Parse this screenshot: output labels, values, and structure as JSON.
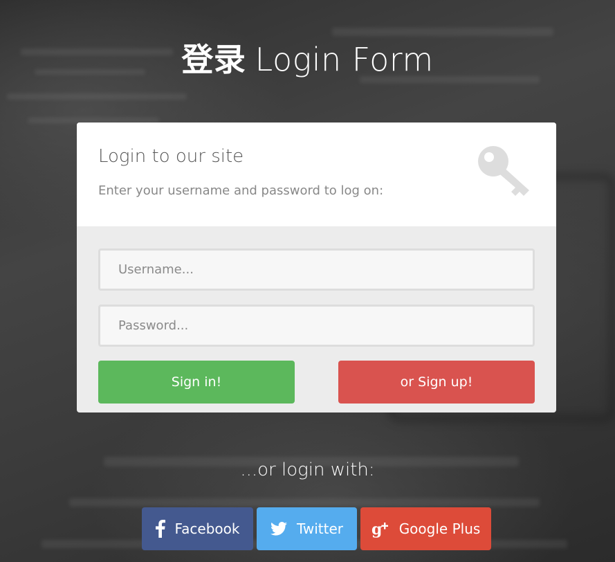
{
  "page": {
    "title_cn": "登录",
    "title_en": "Login Form"
  },
  "card": {
    "heading": "Login to our site",
    "subheading": "Enter your username and password to log on:",
    "icon": "key-icon",
    "username_placeholder": "Username...",
    "password_placeholder": "Password...",
    "signin_label": "Sign in!",
    "signup_label": "or Sign up!"
  },
  "social": {
    "heading": "...or login with:",
    "buttons": [
      {
        "label": "Facebook",
        "icon": "facebook-icon",
        "color": "#44598f"
      },
      {
        "label": "Twitter",
        "icon": "twitter-icon",
        "color": "#55acee"
      },
      {
        "label": "Google Plus",
        "icon": "google-plus-icon",
        "color": "#dd4b39"
      }
    ]
  },
  "colors": {
    "signin": "#5cb85c",
    "signup": "#d9534f",
    "card_top": "#ffffff",
    "card_bottom": "#ececec"
  }
}
